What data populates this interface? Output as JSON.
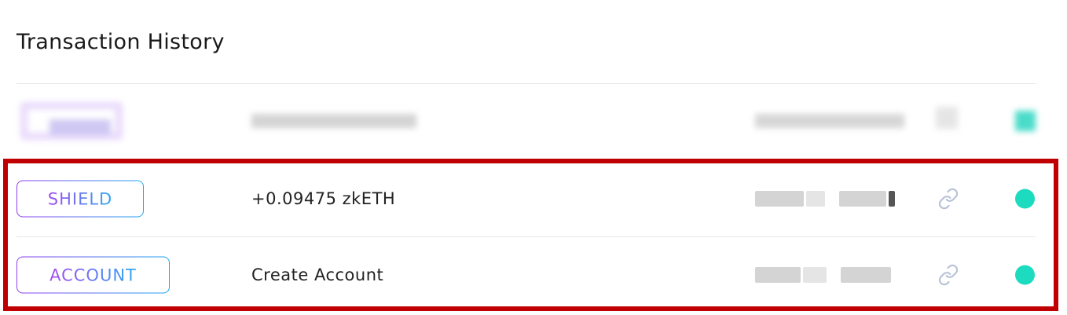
{
  "page": {
    "title": "Transaction History"
  },
  "transactions": [
    {
      "badge": "",
      "description": "",
      "hash": "",
      "status": "confirmed",
      "obscured": true
    },
    {
      "badge": "SHIELD",
      "description": "+0.09475 zkETH",
      "hash": "",
      "status": "confirmed",
      "obscured": false
    },
    {
      "badge": "ACCOUNT",
      "description": "Create Account",
      "hash": "",
      "status": "confirmed",
      "obscured": false
    }
  ],
  "colors": {
    "badge_gradient_start": "#8f3cf0",
    "badge_gradient_end": "#1ea6f2",
    "status_confirmed": "#1ddbbf",
    "highlight_border": "#c00000",
    "link_icon": "#b7c2d6"
  },
  "icons": {
    "link": "link-icon",
    "status": "status-dot"
  }
}
